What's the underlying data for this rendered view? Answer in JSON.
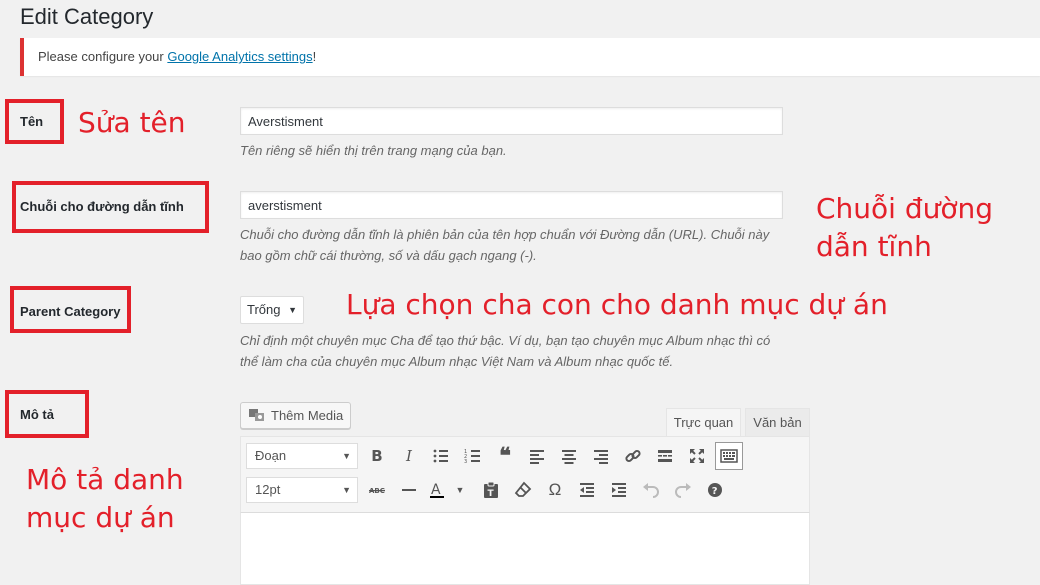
{
  "page": {
    "title": "Edit Category"
  },
  "notice": {
    "prefix": "Please configure your ",
    "link": "Google Analytics settings",
    "suffix": "!"
  },
  "fields": {
    "name": {
      "label": "Tên",
      "value": "Averstisment",
      "description": "Tên riêng sẽ hiển thị trên trang mạng của bạn."
    },
    "slug": {
      "label": "Chuỗi cho đường dẫn tĩnh",
      "value": "averstisment",
      "description_line1": "Chuỗi cho đường dẫn tĩnh là phiên bản của tên hợp chuẩn với Đường dẫn (URL). Chuỗi này",
      "description_line2": "bao gồm chữ cái thường, số và dấu gạch ngang (-)."
    },
    "parent": {
      "label": "Parent Category",
      "selected": "Trống",
      "description_line1": "Chỉ định một chuyên mục Cha để tạo thứ bậc. Ví dụ, bạn tạo chuyên mục Album nhạc thì có",
      "description_line2": "thể làm cha của chuyên mục Album nhạc Việt Nam và Album nhạc quốc tế."
    },
    "description": {
      "label": "Mô tả"
    }
  },
  "editor": {
    "add_media": "Thêm Media",
    "tabs": [
      "Trực quan",
      "Văn bản"
    ],
    "format_select": "Đoạn",
    "size_select": "12pt"
  },
  "annotations": {
    "name": "Sửa tên",
    "slug_line1": "Chuỗi đường",
    "slug_line2": "dẫn tĩnh",
    "parent": "Lựa chọn cha con cho danh mục dự án",
    "desc_line1": "Mô tả danh",
    "desc_line2": "mục dự án"
  },
  "colors": {
    "annotation_red": "#e3202a",
    "notice_border": "#dc3232",
    "link_blue": "#0073aa"
  }
}
